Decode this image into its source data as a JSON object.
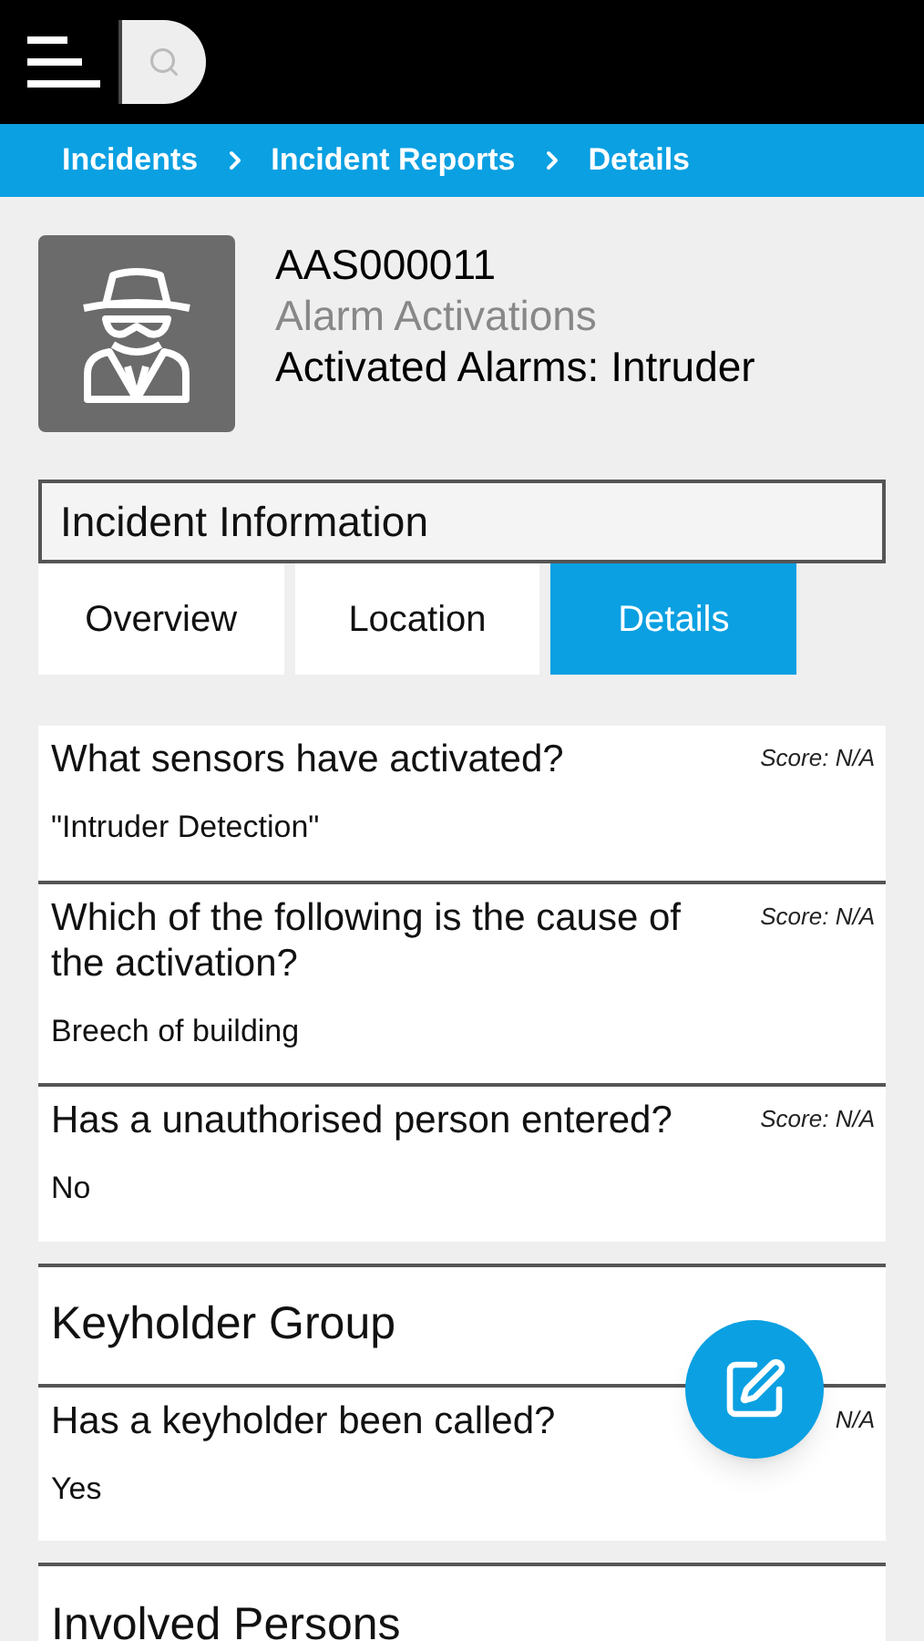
{
  "breadcrumbs": [
    {
      "label": "Incidents"
    },
    {
      "label": "Incident Reports"
    },
    {
      "label": "Details"
    }
  ],
  "incident": {
    "id": "AAS000011",
    "category": "Alarm Activations",
    "type": "Activated Alarms: Intruder"
  },
  "section_title": "Incident Information",
  "tabs": [
    {
      "label": "Overview",
      "selected": false
    },
    {
      "label": "Location",
      "selected": false
    },
    {
      "label": "Details",
      "selected": true
    }
  ],
  "groups": [
    {
      "questions": [
        {
          "question": "What sensors have activated?",
          "score": "Score: N/A",
          "answer": "\"Intruder Detection\""
        },
        {
          "question": "Which of the following is the cause of the activation?",
          "score": "Score: N/A",
          "answer": "Breech of building"
        },
        {
          "question": "Has a unauthorised person entered?",
          "score": "Score: N/A",
          "answer": "No"
        }
      ]
    },
    {
      "title": "Keyholder Group",
      "questions": [
        {
          "question": "Has a keyholder been called?",
          "score": "N/A",
          "answer": "Yes"
        }
      ]
    },
    {
      "title": "Involved Persons"
    }
  ]
}
